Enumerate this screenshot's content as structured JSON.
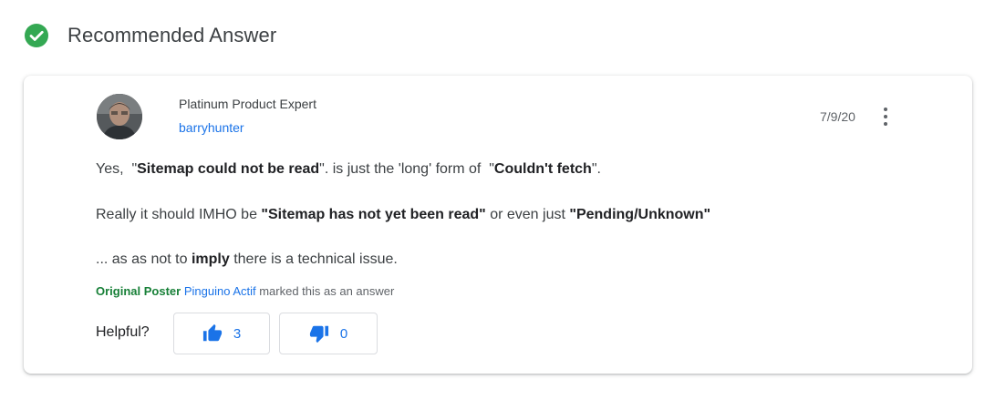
{
  "header": {
    "title": "Recommended Answer",
    "icon": "check-circle-icon",
    "icon_color": "#34a853"
  },
  "post": {
    "author_role": "Platinum Product Expert",
    "author_name": "barryhunter",
    "date": "7/9/20",
    "more_icon": "more-vert-icon",
    "paragraphs": [
      {
        "parts": [
          {
            "text": "Yes,  \"",
            "bold": false
          },
          {
            "text": "Sitemap could not be read",
            "bold": true
          },
          {
            "text": "\". is just the 'long' form of  \"",
            "bold": false
          },
          {
            "text": "Couldn't fetch",
            "bold": true
          },
          {
            "text": "\".",
            "bold": false
          }
        ]
      },
      {
        "parts": [
          {
            "text": "Really it should IMHO be ",
            "bold": false
          },
          {
            "text": "\"Sitemap has not yet been read\"",
            "bold": true
          },
          {
            "text": " or even just ",
            "bold": false
          },
          {
            "text": "\"Pending/Unknown\"",
            "bold": true
          }
        ]
      },
      {
        "parts": [
          {
            "text": "... as as not to ",
            "bold": false
          },
          {
            "text": "imply",
            "bold": true
          },
          {
            "text": " there is a technical issue.",
            "bold": false
          }
        ]
      }
    ],
    "marked_by": {
      "label": "Original Poster",
      "name": "Pinguino Actif",
      "suffix": " marked this as an answer"
    }
  },
  "helpful": {
    "label": "Helpful?",
    "up_icon": "thumb-up-icon",
    "up_count": "3",
    "down_icon": "thumb-down-icon",
    "down_count": "0",
    "accent": "#1a73e8"
  }
}
